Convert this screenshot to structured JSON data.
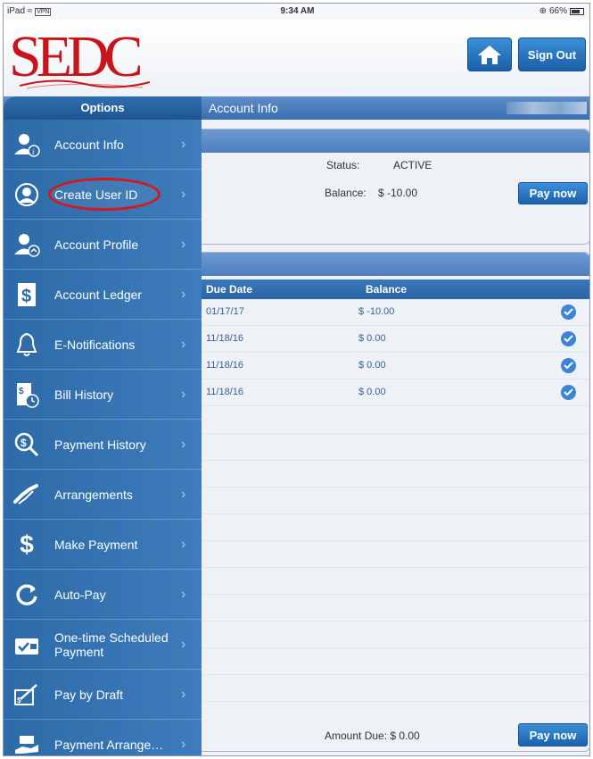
{
  "status_bar": {
    "device": "iPad",
    "carrier": "VPN",
    "time": "9:34 AM",
    "battery": "66%"
  },
  "header": {
    "logo_text": "SEDC",
    "signout_label": "Sign Out"
  },
  "titlebar": {
    "options_label": "Options",
    "page_title": "Account Info"
  },
  "sidebar": {
    "items": [
      {
        "label": "Account Info",
        "icon": "user-info-icon"
      },
      {
        "label": "Create User ID",
        "icon": "create-user-icon"
      },
      {
        "label": "Account Profile",
        "icon": "user-settings-icon"
      },
      {
        "label": "Account Ledger",
        "icon": "ledger-dollar-icon"
      },
      {
        "label": "E-Notifications",
        "icon": "bell-icon"
      },
      {
        "label": "Bill History",
        "icon": "bill-clock-icon"
      },
      {
        "label": "Payment History",
        "icon": "search-dollar-icon"
      },
      {
        "label": "Arrangements",
        "icon": "handshake-icon"
      },
      {
        "label": "Make Payment",
        "icon": "dollar-sign-icon"
      },
      {
        "label": "Auto-Pay",
        "icon": "refresh-icon"
      },
      {
        "label": "One-time Scheduled Payment",
        "icon": "wallet-check-icon"
      },
      {
        "label": "Pay by Draft",
        "icon": "check-draft-icon"
      },
      {
        "label": "Payment Arrange…",
        "icon": "hand-money-icon"
      }
    ]
  },
  "account": {
    "status_label": "Status:",
    "status_value": "ACTIVE",
    "balance_label": "Balance:",
    "balance_value": "$ -10.00",
    "pay_now_label": "Pay now"
  },
  "bills": {
    "columns": [
      "Due Date",
      "Balance"
    ],
    "rows": [
      {
        "due_date": "01/17/17",
        "balance": "$ -10.00"
      },
      {
        "due_date": "11/18/16",
        "balance": "$ 0.00"
      },
      {
        "due_date": "11/18/16",
        "balance": "$ 0.00"
      },
      {
        "due_date": "11/18/16",
        "balance": "$ 0.00"
      }
    ],
    "amount_due": "Amount Due: $ 0.00",
    "pay_now_label": "Pay now"
  },
  "colors": {
    "brand_red": "#c8151b",
    "accent_blue": "#2c6aa8",
    "highlight_red": "#d7161e"
  }
}
